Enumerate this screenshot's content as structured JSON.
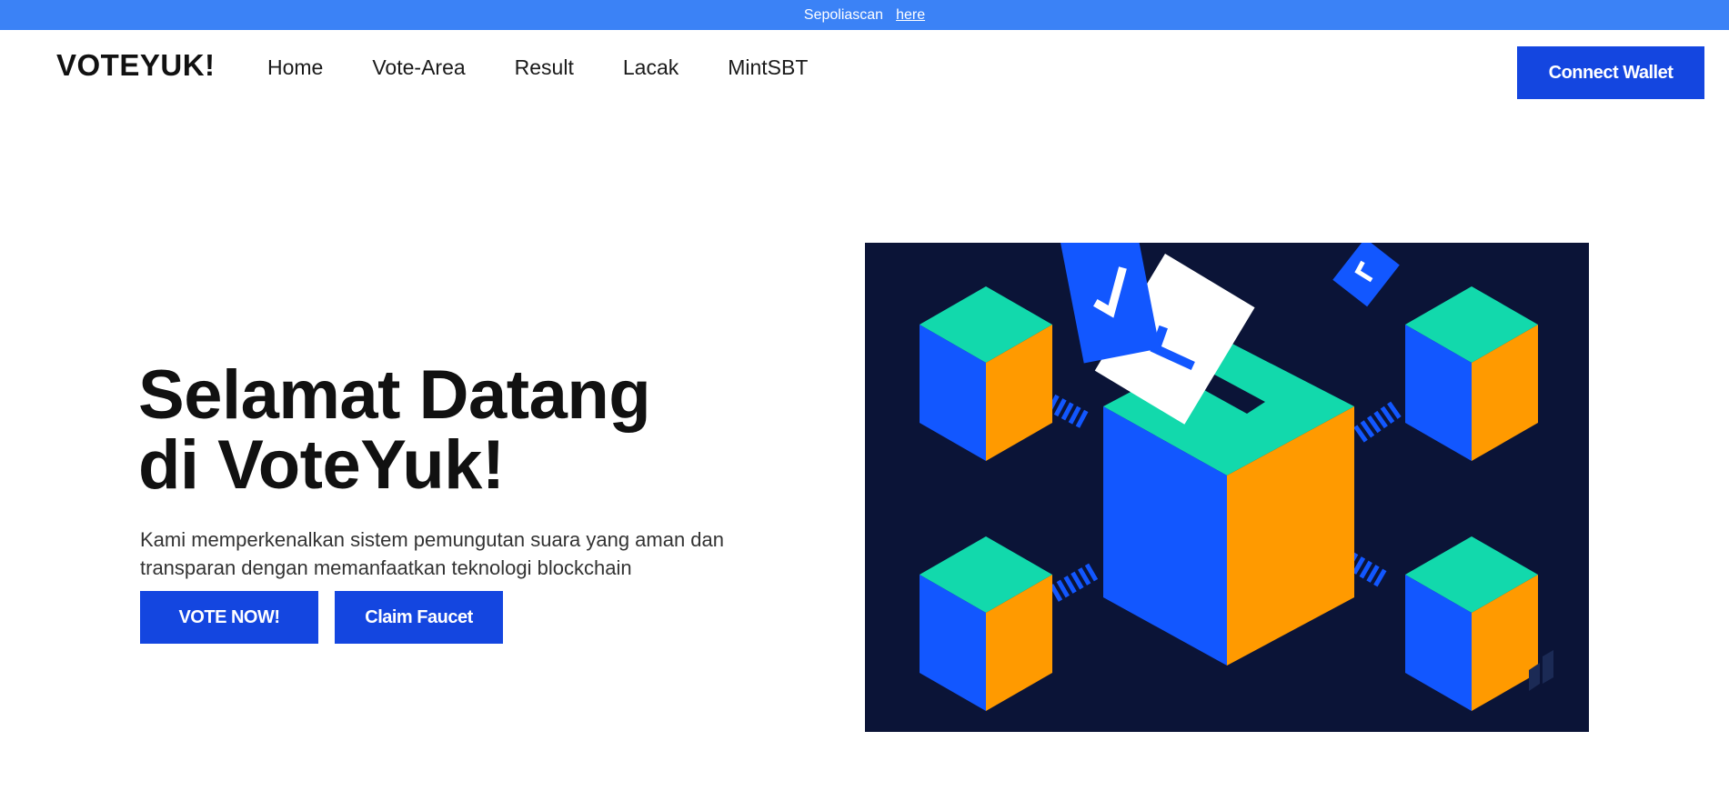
{
  "topbar": {
    "text": "Sepoliascan",
    "link_label": "here"
  },
  "nav": {
    "brand": "VOTEYUK!",
    "items": [
      {
        "label": "Home"
      },
      {
        "label": "Vote-Area"
      },
      {
        "label": "Result"
      },
      {
        "label": "Lacak"
      },
      {
        "label": "MintSBT"
      }
    ],
    "connect_label": "Connect Wallet"
  },
  "hero": {
    "title_line1": "Selamat Datang",
    "title_line2": "di VoteYuk!",
    "subtitle": "Kami memperkenalkan sistem pemungutan suara yang aman dan transparan dengan memanfaatkan teknologi blockchain",
    "vote_label": "VOTE NOW!",
    "faucet_label": "Claim Faucet"
  },
  "illustration": {
    "subject": "ballot-box-blockchain-illustration",
    "colors": {
      "background": "#0b1437",
      "blue": "#1257ff",
      "orange": "#ff9a00",
      "teal": "#12d9ac",
      "white": "#ffffff"
    }
  },
  "colors": {
    "topbar": "#3b82f6",
    "primary_button": "#1446e0"
  }
}
